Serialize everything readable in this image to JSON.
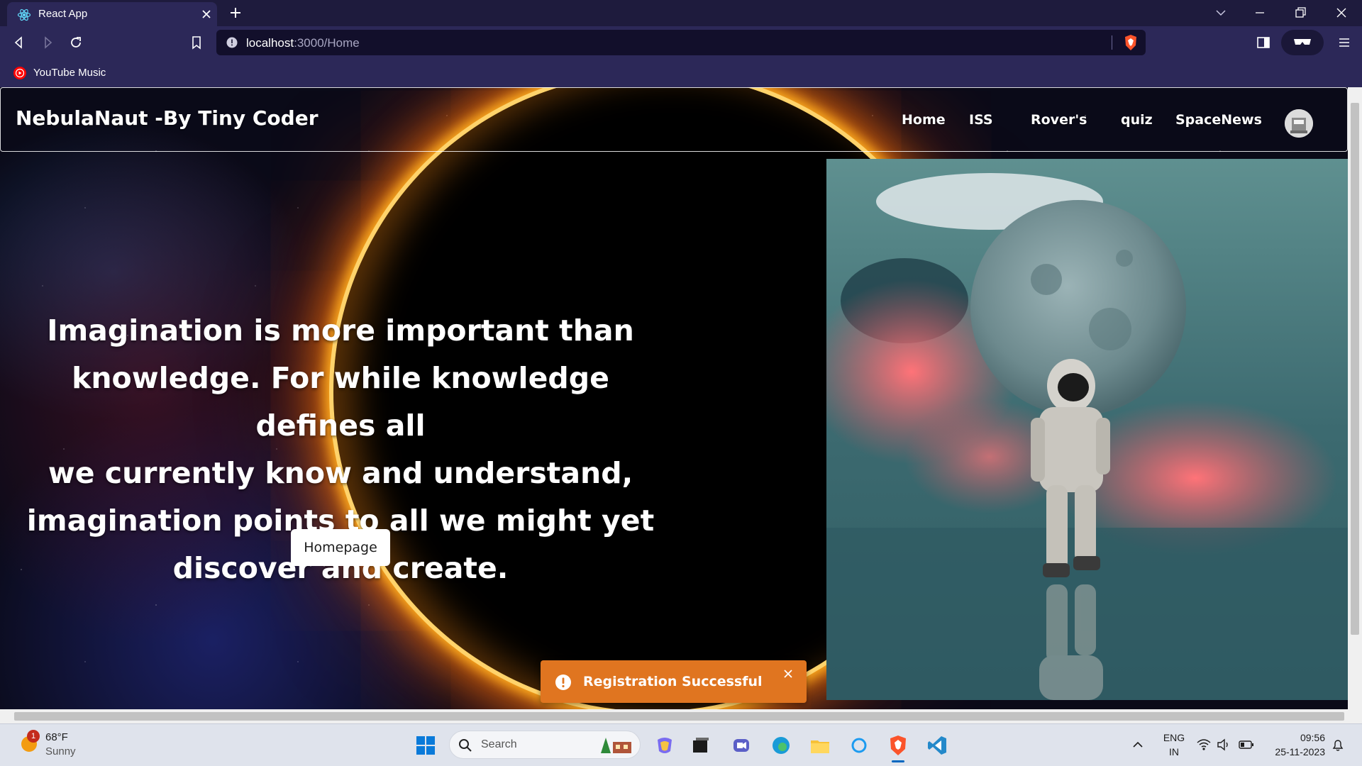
{
  "browser": {
    "tab_title": "React App",
    "url_host": "localhost",
    "url_path": ":3000/Home",
    "bookmarks": [
      {
        "label": "YouTube Music"
      }
    ]
  },
  "site": {
    "brand": "NebulaNaut -By Tiny Coder",
    "nav": [
      {
        "label": "Home"
      },
      {
        "label": "ISS"
      },
      {
        "label": "Rover's"
      },
      {
        "label": "quiz"
      },
      {
        "label": "SpaceNews"
      }
    ]
  },
  "hero": {
    "quote_lines": [
      "Imagination is more important than",
      "knowledge. For while knowledge defines all",
      "we currently know and understand,",
      "imagination points to all we might yet",
      "discover and create."
    ],
    "button_label": "Homepage"
  },
  "toast": {
    "message": "Registration Successful",
    "color": "#e07520"
  },
  "taskbar": {
    "weather": {
      "temp": "68°F",
      "condition": "Sunny",
      "badge": "1"
    },
    "search_label": "Search",
    "language": {
      "line1": "ENG",
      "line2": "IN"
    },
    "time": "09:56",
    "date": "25-11-2023"
  },
  "colors": {
    "browser_tabbar": "#1e1b3d",
    "browser_toolbar": "#2c2858",
    "accent_eclipse": "#ffb020"
  }
}
